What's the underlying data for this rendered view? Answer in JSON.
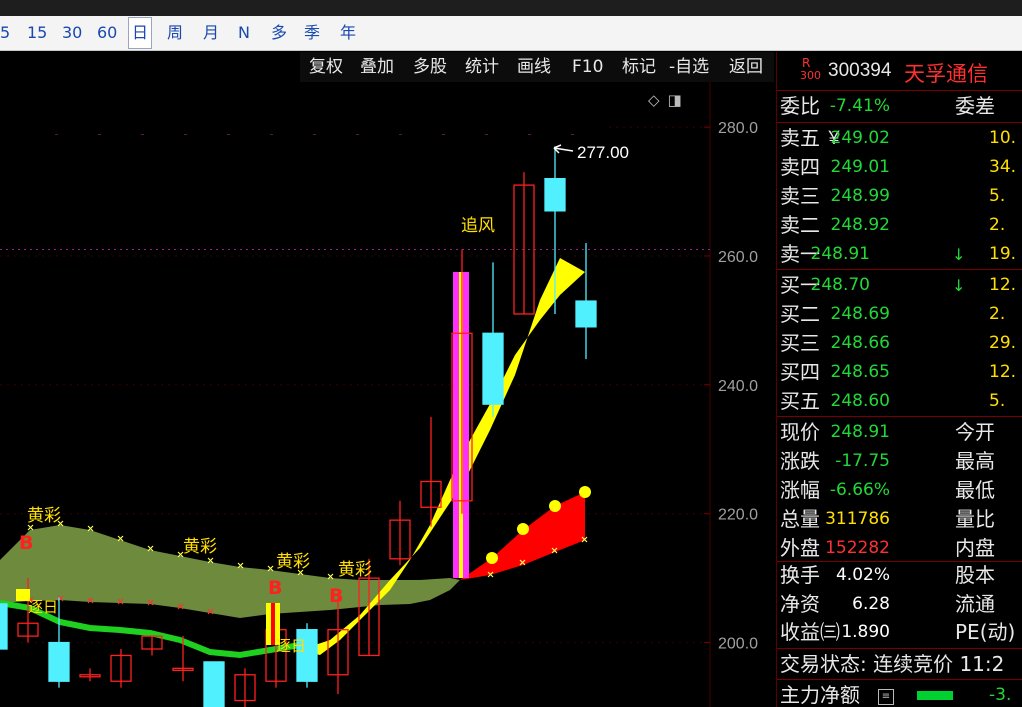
{
  "period_bar": {
    "items": [
      "5",
      "15",
      "30",
      "60",
      "日",
      "周",
      "月",
      "N",
      "多",
      "季",
      "年"
    ],
    "active_index": 4
  },
  "function_bar": {
    "items": [
      "复权",
      "叠加",
      "多股",
      "统计",
      "画线",
      "F10",
      "标记",
      "-自选",
      "返回"
    ]
  },
  "chart": {
    "tool_icons": [
      "diamond-icon",
      "window-icon"
    ],
    "price_ticks": [
      "280.0",
      "260.0",
      "240.0",
      "220.0",
      "200.0"
    ],
    "high_label": "277.00",
    "annotations": {
      "huangcai": "黄彩",
      "zhufeng": "追风",
      "zhuri": "逐日",
      "buy_marker": "B"
    },
    "colors": {
      "up": "#ff2020",
      "down": "#50f0ff",
      "band": "#6e8a3c",
      "ribbon": "#ffff00",
      "accent_bar": "#ff30ff",
      "red_area": "#ff0000",
      "green_line": "#20d020"
    }
  },
  "chart_data": {
    "type": "candlestick",
    "ylim": [
      190,
      287
    ],
    "ticks": [
      280,
      260,
      240,
      220,
      200
    ],
    "dashed_level": 261,
    "candles": [
      {
        "o": 206,
        "c": 199,
        "h": 207,
        "l": 196
      },
      {
        "o": 201,
        "c": 203,
        "h": 210,
        "l": 200
      },
      {
        "o": 200,
        "c": 194,
        "h": 207,
        "l": 193
      },
      {
        "o": 195,
        "c": 195,
        "h": 196,
        "l": 194
      },
      {
        "o": 194,
        "c": 198,
        "h": 199,
        "l": 193
      },
      {
        "o": 199,
        "c": 201,
        "h": 201,
        "l": 198
      },
      {
        "o": 196,
        "c": 196,
        "h": 201,
        "l": 194
      },
      {
        "o": 197,
        "c": 190,
        "h": 197,
        "l": 188
      },
      {
        "o": 191,
        "c": 195,
        "h": 196,
        "l": 189
      },
      {
        "o": 194,
        "c": 202,
        "h": 206,
        "l": 193
      },
      {
        "o": 202,
        "c": 194,
        "h": 203,
        "l": 193
      },
      {
        "o": 195,
        "c": 202,
        "h": 207,
        "l": 192
      },
      {
        "o": 198,
        "c": 210,
        "h": 213,
        "l": 198
      },
      {
        "o": 213,
        "c": 219,
        "h": 222,
        "l": 212
      },
      {
        "o": 221,
        "c": 225,
        "h": 235,
        "l": 218
      },
      {
        "o": 222,
        "c": 248,
        "h": 261,
        "l": 220
      },
      {
        "o": 248,
        "c": 237,
        "h": 259,
        "l": 235
      },
      {
        "o": 251,
        "c": 271,
        "h": 273,
        "l": 251
      },
      {
        "o": 272,
        "c": 267,
        "h": 277,
        "l": 251
      },
      {
        "o": 253,
        "c": 249,
        "h": 262,
        "l": 244
      }
    ]
  },
  "quote": {
    "market_tag": "R",
    "market_sub": "300",
    "code": "300394",
    "name": "天孚通信",
    "webi_label": "委比",
    "webi_value": "-7.41%",
    "weicha_label": "委差",
    "asks": [
      {
        "label": "卖五",
        "mark": "￥",
        "price": "249.02",
        "vol": "10."
      },
      {
        "label": "卖四",
        "mark": "",
        "price": "249.01",
        "vol": "34."
      },
      {
        "label": "卖三",
        "mark": "",
        "price": "248.99",
        "vol": "5."
      },
      {
        "label": "卖二",
        "mark": "",
        "price": "248.92",
        "vol": "2."
      },
      {
        "label": "卖一",
        "mark": "↓",
        "price": "248.91",
        "vol": "19."
      }
    ],
    "bids": [
      {
        "label": "买一",
        "mark": "↓",
        "price": "248.70",
        "vol": "12."
      },
      {
        "label": "买二",
        "mark": "",
        "price": "248.69",
        "vol": "2."
      },
      {
        "label": "买三",
        "mark": "",
        "price": "248.66",
        "vol": "29."
      },
      {
        "label": "买四",
        "mark": "",
        "price": "248.65",
        "vol": "12."
      },
      {
        "label": "买五",
        "mark": "",
        "price": "248.60",
        "vol": "5."
      }
    ],
    "stats": [
      {
        "label": "现价",
        "value": "248.91",
        "color": "#22d838",
        "label2": "今开"
      },
      {
        "label": "涨跌",
        "value": "-17.75",
        "color": "#22d838",
        "label2": "最高"
      },
      {
        "label": "涨幅",
        "value": "-6.66%",
        "color": "#22d838",
        "label2": "最低"
      },
      {
        "label": "总量",
        "value": "311786",
        "color": "#ffe000",
        "label2": "量比"
      },
      {
        "label": "外盘",
        "value": "152282",
        "color": "#ff3030",
        "label2": "内盘"
      }
    ],
    "stats2": [
      {
        "label": "换手",
        "value": "4.02%",
        "label2": "股本"
      },
      {
        "label": "净资",
        "value": "6.28",
        "label2": "流通"
      },
      {
        "label": "收益㈢",
        "value": "1.890",
        "label2": "PE(动)"
      }
    ],
    "trade_status": "交易状态: 连续竞价 11:2",
    "main_net_label": "主力净额",
    "main_net_value": "-3."
  }
}
